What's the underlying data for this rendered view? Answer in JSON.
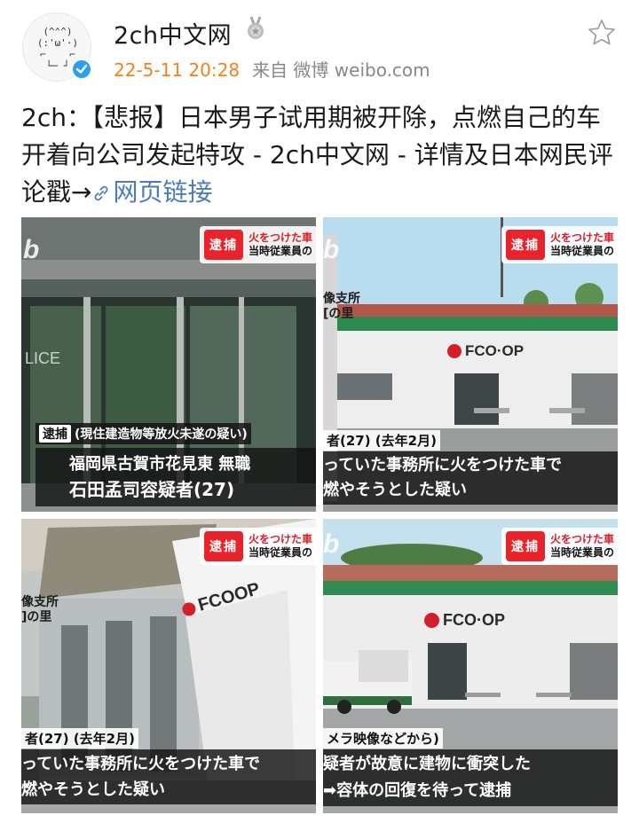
{
  "post": {
    "username": "2ch中文网",
    "time": "22-5-11 20:28",
    "source": "来自 微博 weibo.com",
    "text": "2ch：【悲报】日本男子试用期被开除，点燃自己的车开着向公司发起特攻 - 2ch中文网 - 详情及日本网民评论戳→",
    "link_label": "网页链接"
  },
  "avatar": {
    "art": "(^⌃^)\n(:'ω'·)\n⌐    ⌐\n└─ ┘"
  },
  "images": [
    {
      "logo": "b",
      "badge": {
        "tag": "逮捕",
        "line1": "火をつけた車",
        "line2": "当時従業員の"
      },
      "sign": "LICE",
      "caption_tag": "逮捕",
      "caption_line1": "(現住建造物等放火未遂の疑い)",
      "caption_line2": "福岡県古賀市花見東 無職",
      "caption_line3": "石田孟司容疑者(27)"
    },
    {
      "logo": "b",
      "badge": {
        "tag": "逮捕",
        "line1": "火をつけた車",
        "line2": "当時従業員の"
      },
      "sign": "像支所\n[の里",
      "fcoop": "FCO·OP",
      "caption_line1": "者(27) (去年2月)",
      "caption_line2": "っていた事務所に火をつけた車で",
      "caption_line3": "燃やそうとした疑い"
    },
    {
      "badge": {
        "tag": "逮捕",
        "line1": "火をつけた車",
        "line2": "当時従業員の"
      },
      "sign": "像支所\n]の里",
      "fcoop": "FCOOP",
      "caption_line1": "者(27) (去年2月)",
      "caption_line2": "っていた事務所に火をつけた車で",
      "caption_line3": "燃やそうとした疑い"
    },
    {
      "logo": "b",
      "badge": {
        "tag": "逮捕",
        "line1": "火をつけた車",
        "line2": "当時従業員の"
      },
      "fcoop": "FCO·OP",
      "caption_line1": "メラ映像などから)",
      "caption_line2": "疑者が故意に建物に衝突した",
      "caption_line3": "➡容体の回復を待って逮捕"
    }
  ]
}
